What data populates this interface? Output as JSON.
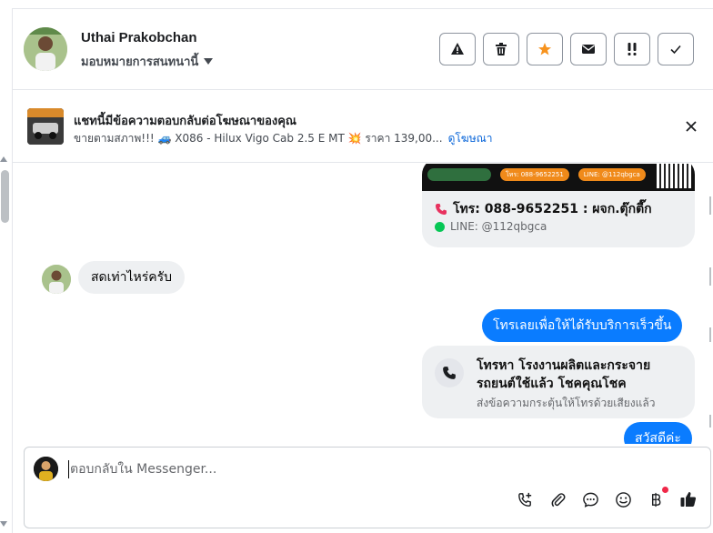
{
  "header": {
    "contact_name": "Uthai Prakobchan",
    "assign_label": "มอบหมายการสนทนานี้",
    "actions": [
      {
        "name": "report-spam-button",
        "icon": "warning-triangle-icon"
      },
      {
        "name": "delete-button",
        "icon": "trash-icon"
      },
      {
        "name": "star-button",
        "icon": "star-icon"
      },
      {
        "name": "mark-unread-button",
        "icon": "envelope-icon"
      },
      {
        "name": "follow-up-button",
        "icon": "double-exclamation-icon"
      },
      {
        "name": "mark-done-button",
        "icon": "check-icon"
      }
    ],
    "star_color": "#f7931e"
  },
  "ad": {
    "title": "แชทนี้มีข้อความตอบกลับต่อโฆษณาของคุณ",
    "subtitle": "ขายตามสภาพ!!! 🚙 X086 - Hilux Vigo Cab 2.5 E MT 💥 ราคา 139,00...",
    "link": "ดูโฆษณา"
  },
  "messages": {
    "card_phone": "โทร: 088-9652251 : ผจก.ตุ๊กตี๊ก",
    "card_line": "LINE: @112qbgca",
    "banner_phone": "โทร: 088-9652251",
    "banner_line": "LINE: @112qbgca",
    "incoming_1": "สดเท่าไหร่ครับ",
    "outgoing_1": "โทรเลยเพื่อให้ได้รับบริการเร็วขึ้น",
    "call_title": "โทรหา โรงงานผลิตและกระจายรถยนต์ใช้แล้ว โชคคุณโชค",
    "call_subtitle": "ส่งข้อความกระตุ้นให้โทรด้วยเสียงแล้ว",
    "outgoing_2": "สวัสดีค่ะ"
  },
  "composer": {
    "placeholder": "ตอบกลับใน Messenger...",
    "tools": [
      "phone-plus-icon",
      "paperclip-icon",
      "chat-bubble-icon",
      "emoji-icon",
      "baht-icon",
      "thumbs-up-icon"
    ]
  },
  "colors": {
    "accent": "#0a7cff",
    "link": "#0a66d9",
    "bubble_in": "#eef0f2"
  }
}
